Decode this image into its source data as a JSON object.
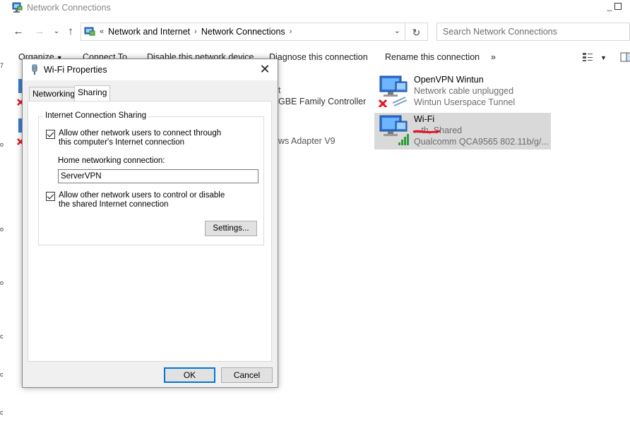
{
  "window": {
    "title": "Network Connections"
  },
  "address_bar": {
    "overflow_marker": "«",
    "breadcrumbs": [
      "Network and Internet",
      "Network Connections"
    ]
  },
  "search": {
    "placeholder": "Search Network Connections"
  },
  "command_bar": {
    "organize": "Organize",
    "connect_to": "Connect To",
    "disable_device": "Disable this network device",
    "diagnose": "Diagnose this connection",
    "rename": "Rename this connection",
    "more": "»"
  },
  "connections": [
    {
      "name": "OpenVPN Wintun",
      "status": "Network cable unplugged",
      "device": "Wintun Userspace Tunnel",
      "selected": false
    },
    {
      "name": "Wi-Fi",
      "status": "...th, Shared",
      "device": "Qualcomm QCA9565 802.11b/g/...",
      "selected": true
    }
  ],
  "background_fragments": {
    "gbe": "GBE Family Controller",
    "adapter": "ws Adapter V9",
    "t": "t"
  },
  "left_strip_glyphs": [
    "7",
    "o",
    "o",
    "o",
    "c",
    "c",
    "c"
  ],
  "dialog": {
    "title": "Wi-Fi Properties",
    "tabs": [
      "Networking",
      "Sharing"
    ],
    "active_tab": "Sharing",
    "group_title": "Internet Connection Sharing",
    "allow_connect": {
      "checked": true,
      "label": "Allow other network users to connect through this computer's Internet connection"
    },
    "home_label": "Home networking connection:",
    "home_value": "ServerVPN",
    "allow_control": {
      "checked": true,
      "label": "Allow other network users to control or disable the shared Internet connection"
    },
    "settings_button": "Settings...",
    "ok_button": "OK",
    "cancel_button": "Cancel"
  },
  "colors": {
    "accent": "#0078d7",
    "selection": "#d9d9d9",
    "error_red": "#e81123",
    "signal_green": "#2e9e3b"
  }
}
